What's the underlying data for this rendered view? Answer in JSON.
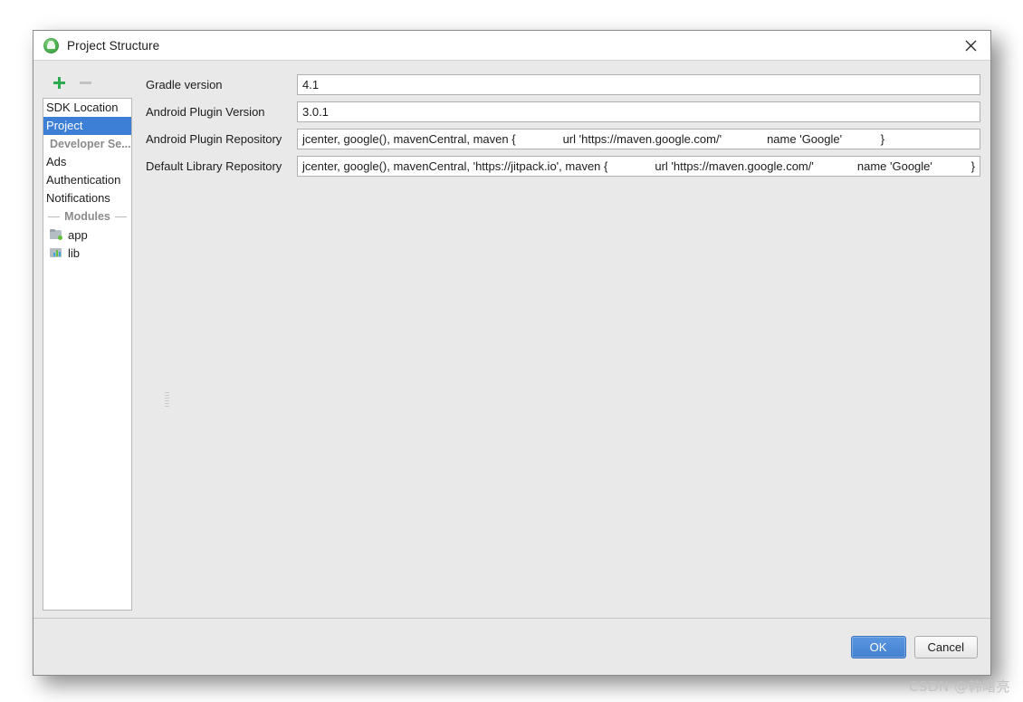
{
  "window": {
    "title": "Project Structure",
    "app_icon": "android-studio-icon",
    "close_icon": "close-icon"
  },
  "toolbar": {
    "add_icon": "plus-icon",
    "remove_icon": "minus-icon"
  },
  "sidebar": {
    "items": [
      {
        "label": "SDK Location",
        "type": "item",
        "selected": false
      },
      {
        "label": "Project",
        "type": "item",
        "selected": true
      },
      {
        "label": "Developer Se...",
        "type": "group"
      },
      {
        "label": "Ads",
        "type": "item",
        "selected": false
      },
      {
        "label": "Authentication",
        "type": "item",
        "selected": false
      },
      {
        "label": "Notifications",
        "type": "item",
        "selected": false
      }
    ],
    "modules_header": "Modules",
    "modules": [
      {
        "label": "app",
        "icon": "module-folder-icon"
      },
      {
        "label": "lib",
        "icon": "module-library-icon"
      }
    ]
  },
  "fields": [
    {
      "label": "Gradle version",
      "value": "4.1",
      "simple": true
    },
    {
      "label": "Android Plugin Version",
      "value": "3.0.1",
      "simple": true
    },
    {
      "label": "Android Plugin Repository",
      "simple": false,
      "part1": "jcenter, google(), mavenCentral, maven {",
      "part2": "url 'https://maven.google.com/'",
      "part3": "name 'Google'",
      "part4": "}"
    },
    {
      "label": "Default Library Repository",
      "simple": false,
      "part1": "jcenter, google(), mavenCentral, 'https://jitpack.io', maven {",
      "part2": "url 'https://maven.google.com/'",
      "part3": "name 'Google'",
      "part4": "}"
    }
  ],
  "footer": {
    "ok_label": "OK",
    "cancel_label": "Cancel"
  },
  "watermark": "CSDN @韩曙亮",
  "colors": {
    "selection_blue": "#3d7fd6",
    "ok_button_blue": "#4280cf",
    "add_icon_green": "#2faa4e",
    "window_background": "#e9e9e9"
  }
}
